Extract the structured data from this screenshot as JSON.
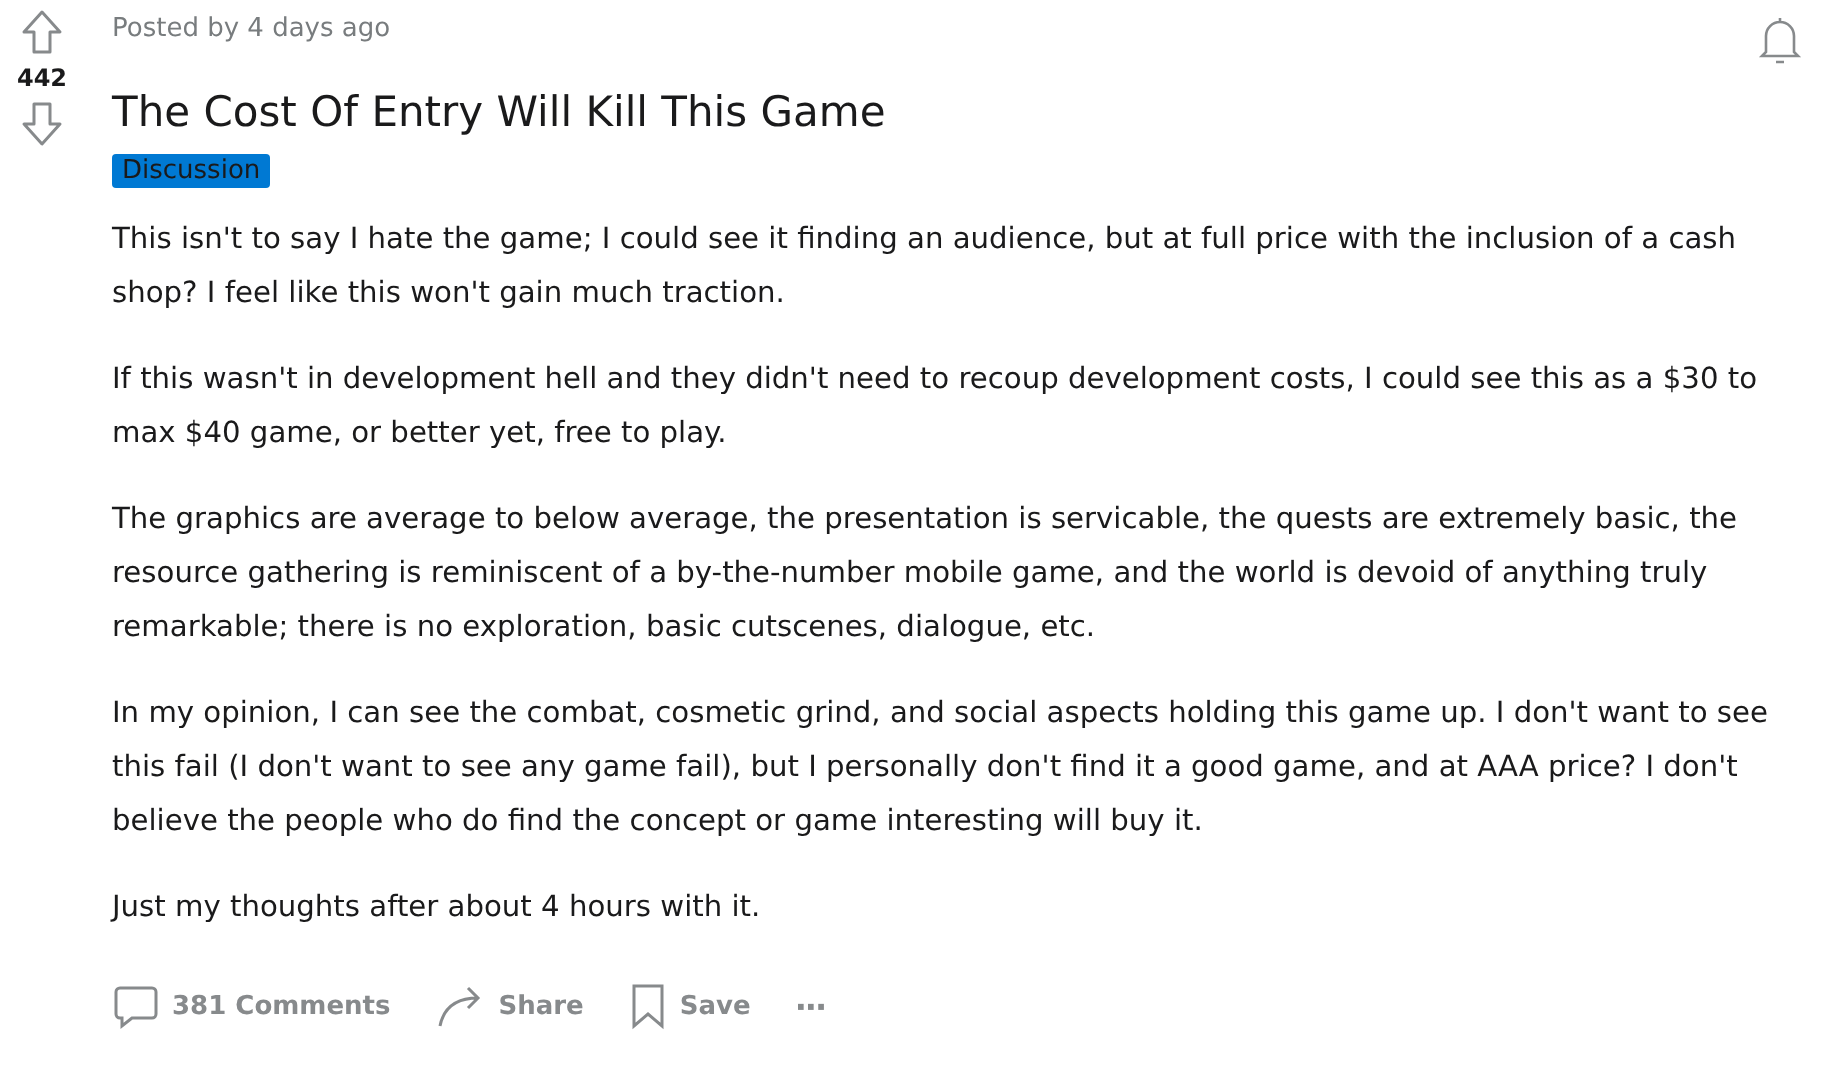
{
  "post": {
    "meta": "Posted by 4 days ago",
    "score": "442",
    "title": "The Cost Of Entry Will Kill This Game",
    "flair": "Discussion",
    "paragraphs": [
      "This isn't to say I hate the game; I could see it finding an audience, but at full price with the inclusion of a cash shop? I feel like this won't gain much traction.",
      "If this wasn't in development hell and they didn't need to recoup development costs, I could see this as a $30 to max $40 game, or better yet, free to play.",
      "The graphics are average to below average, the presentation is servicable, the quests are extremely basic, the resource gathering is reminiscent of a by-the-number mobile game, and the world is devoid of anything truly remarkable; there is no exploration, basic cutscenes, dialogue, etc.",
      "In my opinion, I can see the combat, cosmetic grind, and social aspects holding this game up. I don't want to see this fail (I don't want to see any game fail), but I personally don't find it a good game, and at AAA price? I don't believe the people who do find the concept or game interesting will buy it.",
      "Just my thoughts after about 4 hours with it."
    ],
    "actions": [
      {
        "kind": "comments",
        "label": "381 Comments"
      },
      {
        "kind": "share",
        "label": "Share"
      },
      {
        "kind": "save",
        "label": "Save"
      },
      {
        "kind": "more",
        "label": "···"
      }
    ]
  }
}
